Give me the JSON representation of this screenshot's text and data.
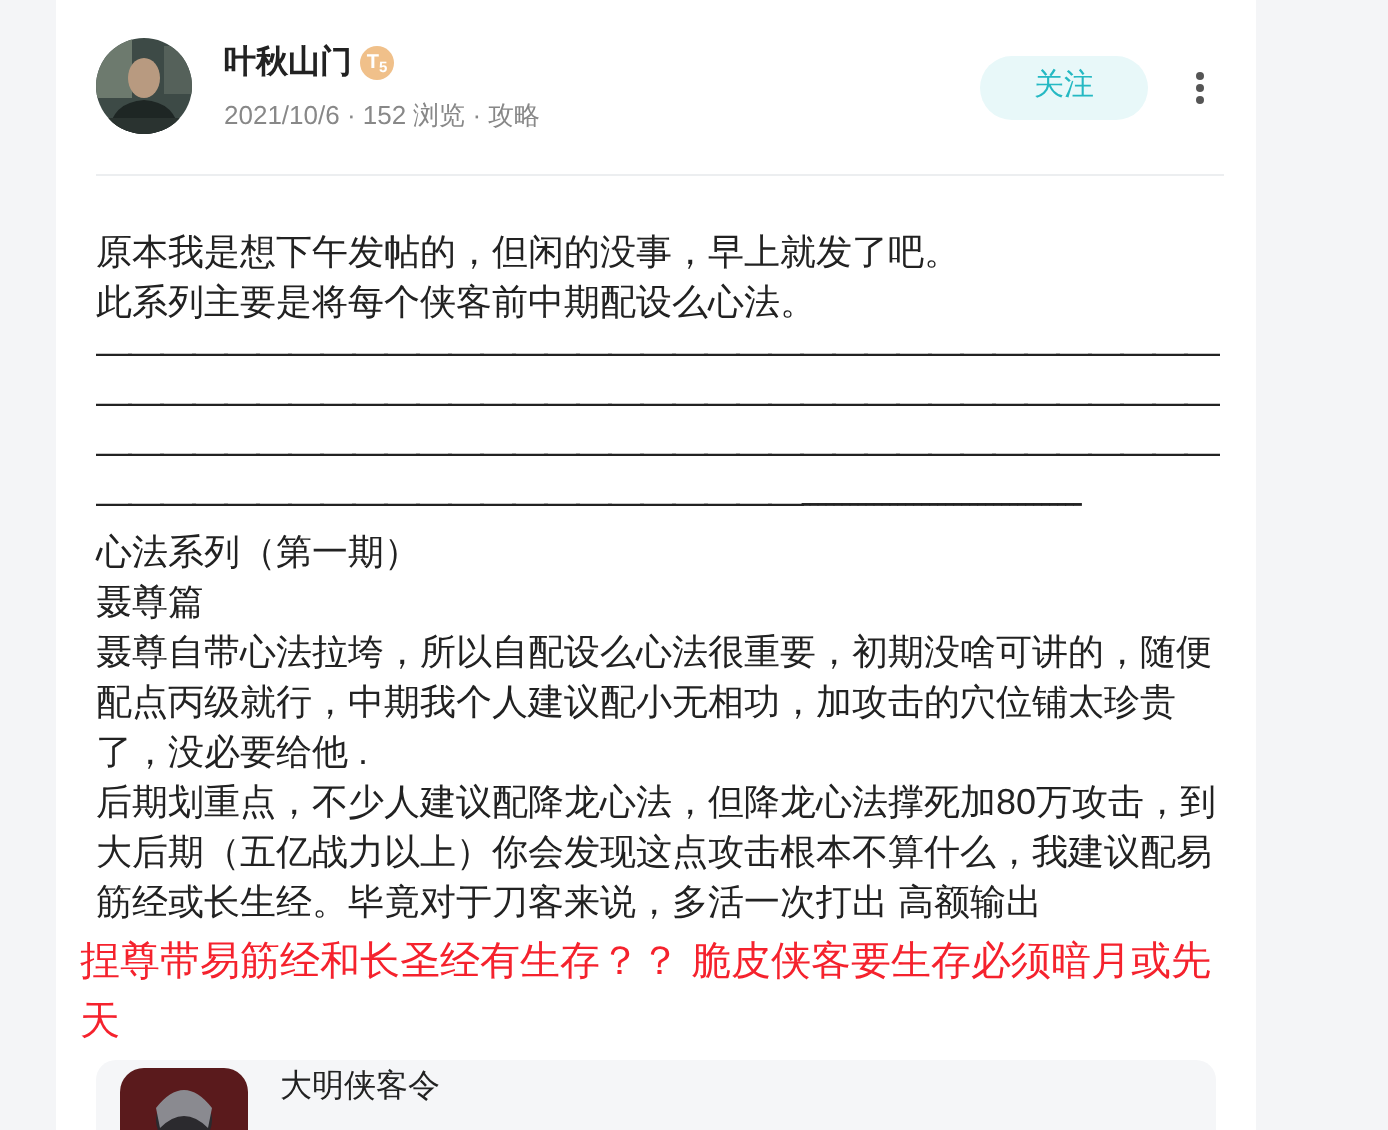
{
  "author": {
    "name": "叶秋山门",
    "badge": "T$_{5}$",
    "meta": "2021/10/6 · 152 浏览 · 攻略"
  },
  "follow_button": {
    "label": "关注"
  },
  "body": [
    {
      "kind": "text",
      "text": "原本我是想下午发帖的，但闲的没事，早上就发了吧。"
    },
    {
      "kind": "text",
      "text": "此系列主要是将每个侠客前中期配设么心法。"
    },
    {
      "kind": "rule",
      "text": "———————————————————————————————————"
    },
    {
      "kind": "rule",
      "text": "———————————————————————————————————"
    },
    {
      "kind": "rule",
      "text": "———————————————————————————————————"
    },
    {
      "kind": "rule",
      "text": "——————————————————————-----------------------------------"
    },
    {
      "kind": "text",
      "text": "心法系列（第一期）"
    },
    {
      "kind": "text",
      "text": "聂尊篇"
    },
    {
      "kind": "text",
      "text": "聂尊自带心法拉垮，所以自配设么心法很重要，初期没啥可讲的，随便配点丙级就行，中期我个人建议配小无相功，加攻击的穴位铺太珍贵了，没必要给他 ."
    },
    {
      "kind": "text",
      "text": "后期划重点，不少人建议配降龙心法，但降龙心法撑死加80万攻击，到大后期（五亿战力以上）你会发现这点攻击根本不算什么，我建议配易筋经或长生经。毕竟对于刀客来说，多活一次打出 高额输出"
    },
    {
      "kind": "highlight",
      "text": "捏尊带易筋经和长圣经有生存？？ 脆皮侠客要生存必须暗月或先天"
    }
  ],
  "linked_card": {
    "title": "大明侠客令"
  }
}
